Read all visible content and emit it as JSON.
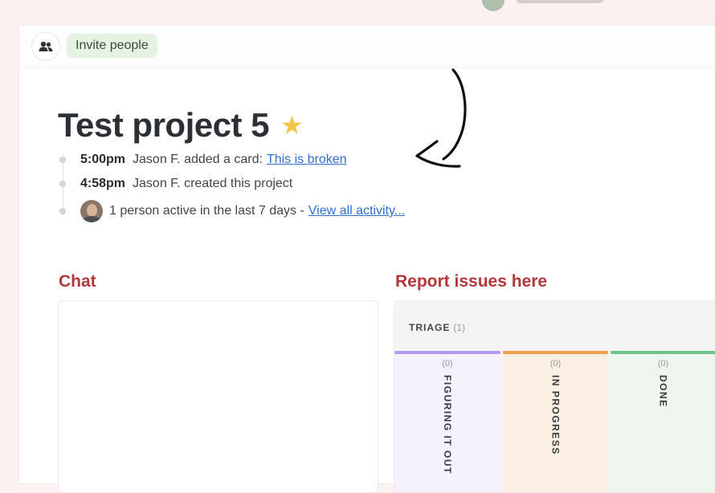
{
  "header": {
    "invite_label": "Invite people",
    "people_icon": "people-icon"
  },
  "project": {
    "title": "Test project 5",
    "star_icon": "star-icon",
    "star_color": "#f2c64b"
  },
  "activity": [
    {
      "time": "5:00pm",
      "text": "Jason F. added a card:",
      "link": "This is broken"
    },
    {
      "time": "4:58pm",
      "text": "Jason F. created this project"
    },
    {
      "text": "1 person active in the last 7 days -",
      "link": "View all activity..."
    }
  ],
  "sections": {
    "chat_title": "Chat",
    "report_title": "Report issues here"
  },
  "board": {
    "triage_label": "TRIAGE",
    "triage_count": "(1)",
    "columns": [
      {
        "label": "FIGURING IT OUT",
        "count": "(0)",
        "color": "#b39af0"
      },
      {
        "label": "IN PROGRESS",
        "count": "(0)",
        "color": "#f0a04a"
      },
      {
        "label": "DONE",
        "count": "(0)",
        "color": "#6cc28a"
      }
    ]
  },
  "colors": {
    "accent_red": "#b3363a",
    "link_blue": "#2f6fcf",
    "invite_bg": "#e6f2e2"
  }
}
